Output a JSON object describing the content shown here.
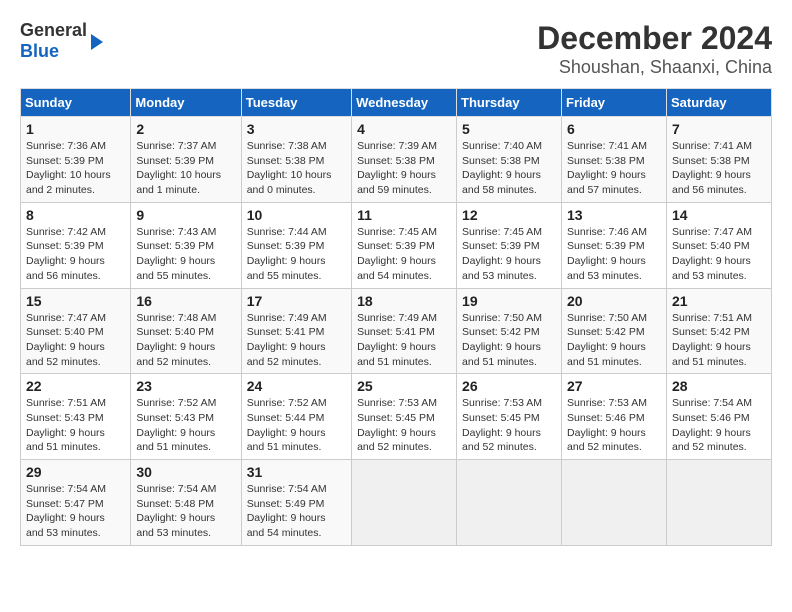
{
  "header": {
    "logo_line1": "General",
    "logo_line2": "Blue",
    "title": "December 2024",
    "subtitle": "Shoushan, Shaanxi, China"
  },
  "days_of_week": [
    "Sunday",
    "Monday",
    "Tuesday",
    "Wednesday",
    "Thursday",
    "Friday",
    "Saturday"
  ],
  "weeks": [
    [
      {
        "day": "1",
        "info": "Sunrise: 7:36 AM\nSunset: 5:39 PM\nDaylight: 10 hours\nand 2 minutes."
      },
      {
        "day": "2",
        "info": "Sunrise: 7:37 AM\nSunset: 5:39 PM\nDaylight: 10 hours\nand 1 minute."
      },
      {
        "day": "3",
        "info": "Sunrise: 7:38 AM\nSunset: 5:38 PM\nDaylight: 10 hours\nand 0 minutes."
      },
      {
        "day": "4",
        "info": "Sunrise: 7:39 AM\nSunset: 5:38 PM\nDaylight: 9 hours\nand 59 minutes."
      },
      {
        "day": "5",
        "info": "Sunrise: 7:40 AM\nSunset: 5:38 PM\nDaylight: 9 hours\nand 58 minutes."
      },
      {
        "day": "6",
        "info": "Sunrise: 7:41 AM\nSunset: 5:38 PM\nDaylight: 9 hours\nand 57 minutes."
      },
      {
        "day": "7",
        "info": "Sunrise: 7:41 AM\nSunset: 5:38 PM\nDaylight: 9 hours\nand 56 minutes."
      }
    ],
    [
      {
        "day": "8",
        "info": "Sunrise: 7:42 AM\nSunset: 5:39 PM\nDaylight: 9 hours\nand 56 minutes."
      },
      {
        "day": "9",
        "info": "Sunrise: 7:43 AM\nSunset: 5:39 PM\nDaylight: 9 hours\nand 55 minutes."
      },
      {
        "day": "10",
        "info": "Sunrise: 7:44 AM\nSunset: 5:39 PM\nDaylight: 9 hours\nand 55 minutes."
      },
      {
        "day": "11",
        "info": "Sunrise: 7:45 AM\nSunset: 5:39 PM\nDaylight: 9 hours\nand 54 minutes."
      },
      {
        "day": "12",
        "info": "Sunrise: 7:45 AM\nSunset: 5:39 PM\nDaylight: 9 hours\nand 53 minutes."
      },
      {
        "day": "13",
        "info": "Sunrise: 7:46 AM\nSunset: 5:39 PM\nDaylight: 9 hours\nand 53 minutes."
      },
      {
        "day": "14",
        "info": "Sunrise: 7:47 AM\nSunset: 5:40 PM\nDaylight: 9 hours\nand 53 minutes."
      }
    ],
    [
      {
        "day": "15",
        "info": "Sunrise: 7:47 AM\nSunset: 5:40 PM\nDaylight: 9 hours\nand 52 minutes."
      },
      {
        "day": "16",
        "info": "Sunrise: 7:48 AM\nSunset: 5:40 PM\nDaylight: 9 hours\nand 52 minutes."
      },
      {
        "day": "17",
        "info": "Sunrise: 7:49 AM\nSunset: 5:41 PM\nDaylight: 9 hours\nand 52 minutes."
      },
      {
        "day": "18",
        "info": "Sunrise: 7:49 AM\nSunset: 5:41 PM\nDaylight: 9 hours\nand 51 minutes."
      },
      {
        "day": "19",
        "info": "Sunrise: 7:50 AM\nSunset: 5:42 PM\nDaylight: 9 hours\nand 51 minutes."
      },
      {
        "day": "20",
        "info": "Sunrise: 7:50 AM\nSunset: 5:42 PM\nDaylight: 9 hours\nand 51 minutes."
      },
      {
        "day": "21",
        "info": "Sunrise: 7:51 AM\nSunset: 5:42 PM\nDaylight: 9 hours\nand 51 minutes."
      }
    ],
    [
      {
        "day": "22",
        "info": "Sunrise: 7:51 AM\nSunset: 5:43 PM\nDaylight: 9 hours\nand 51 minutes."
      },
      {
        "day": "23",
        "info": "Sunrise: 7:52 AM\nSunset: 5:43 PM\nDaylight: 9 hours\nand 51 minutes."
      },
      {
        "day": "24",
        "info": "Sunrise: 7:52 AM\nSunset: 5:44 PM\nDaylight: 9 hours\nand 51 minutes."
      },
      {
        "day": "25",
        "info": "Sunrise: 7:53 AM\nSunset: 5:45 PM\nDaylight: 9 hours\nand 52 minutes."
      },
      {
        "day": "26",
        "info": "Sunrise: 7:53 AM\nSunset: 5:45 PM\nDaylight: 9 hours\nand 52 minutes."
      },
      {
        "day": "27",
        "info": "Sunrise: 7:53 AM\nSunset: 5:46 PM\nDaylight: 9 hours\nand 52 minutes."
      },
      {
        "day": "28",
        "info": "Sunrise: 7:54 AM\nSunset: 5:46 PM\nDaylight: 9 hours\nand 52 minutes."
      }
    ],
    [
      {
        "day": "29",
        "info": "Sunrise: 7:54 AM\nSunset: 5:47 PM\nDaylight: 9 hours\nand 53 minutes."
      },
      {
        "day": "30",
        "info": "Sunrise: 7:54 AM\nSunset: 5:48 PM\nDaylight: 9 hours\nand 53 minutes."
      },
      {
        "day": "31",
        "info": "Sunrise: 7:54 AM\nSunset: 5:49 PM\nDaylight: 9 hours\nand 54 minutes."
      },
      {
        "day": "",
        "info": ""
      },
      {
        "day": "",
        "info": ""
      },
      {
        "day": "",
        "info": ""
      },
      {
        "day": "",
        "info": ""
      }
    ]
  ]
}
